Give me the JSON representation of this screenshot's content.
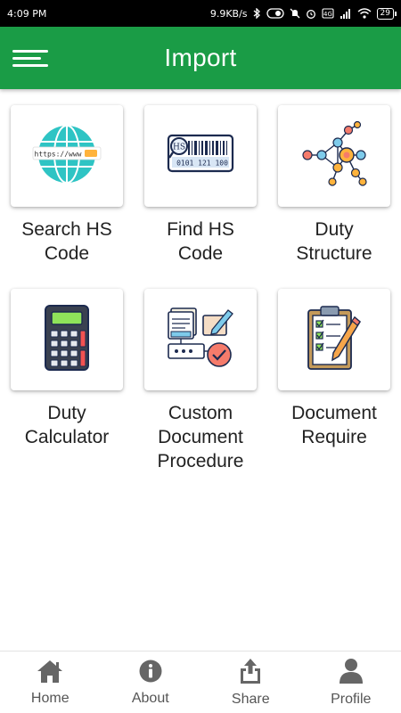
{
  "status_bar": {
    "time": "4:09 PM",
    "network_speed": "9.9KB/s",
    "battery_level": "29",
    "icons": [
      "bluetooth-icon",
      "toggle-icon",
      "mute-icon",
      "alarm-icon",
      "volte-icon",
      "signal-icon",
      "wifi-icon",
      "battery-icon"
    ]
  },
  "app_bar": {
    "title": "Import",
    "menu_icon": "hamburger-menu-icon",
    "background_color": "#1a9c46"
  },
  "tiles": [
    {
      "label": "Search HS Code",
      "lines": [
        "Search HS",
        "Code"
      ],
      "icon": "globe-www-icon"
    },
    {
      "label": "Find HS Code",
      "lines": [
        "Find HS",
        "Code"
      ],
      "icon": "barcode-hs-icon"
    },
    {
      "label": "Duty Structure",
      "lines": [
        "Duty",
        "Structure"
      ],
      "icon": "network-nodes-icon"
    },
    {
      "label": "Duty Calculator",
      "lines": [
        "Duty",
        "Calculator"
      ],
      "icon": "calculator-icon"
    },
    {
      "label": "Custom Document Procedure",
      "lines": [
        "Custom",
        "Document",
        "Procedure"
      ],
      "icon": "document-procedure-icon"
    },
    {
      "label": "Document Require",
      "lines": [
        "Document",
        "Require"
      ],
      "icon": "clipboard-checklist-icon"
    }
  ],
  "globe_text": "https://www",
  "barcode_text": {
    "hs": "HS",
    "digits": "0101 121 100"
  },
  "bottom_nav": [
    {
      "label": "Home",
      "icon": "home-icon"
    },
    {
      "label": "About",
      "icon": "info-icon"
    },
    {
      "label": "Share",
      "icon": "share-icon"
    },
    {
      "label": "Profile",
      "icon": "profile-icon"
    }
  ]
}
